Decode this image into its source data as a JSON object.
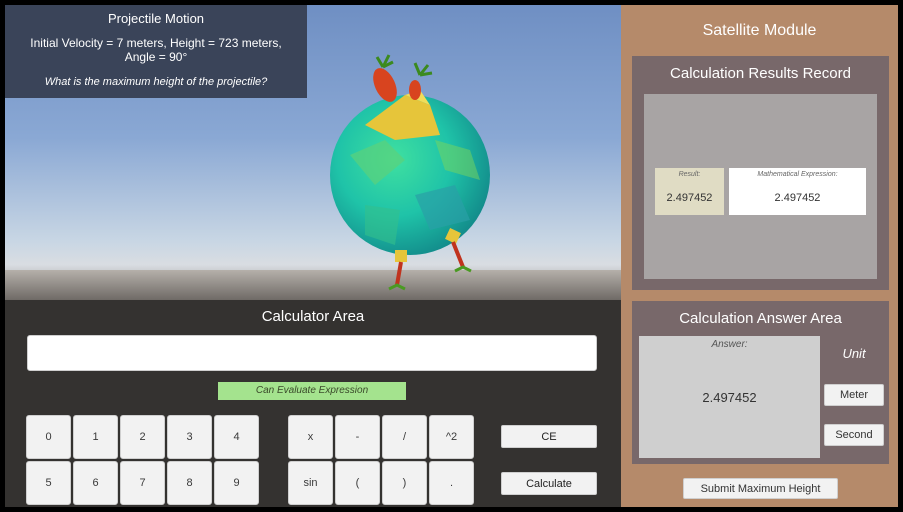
{
  "question": {
    "title": "Projectile Motion",
    "description": "Initial Velocity = 7 meters, Height = 723 meters, Angle = 90°",
    "ask": "What is the maximum height of the projectile?"
  },
  "calculator": {
    "title": "Calculator Area",
    "input_value": "",
    "status": "Can Evaluate Expression",
    "digits": [
      "0",
      "1",
      "2",
      "3",
      "4",
      "5",
      "6",
      "7",
      "8",
      "9"
    ],
    "ops": [
      "x",
      "-",
      "/",
      "^2",
      "sin",
      "(",
      ")",
      "."
    ],
    "ce_label": "CE",
    "calculate_label": "Calculate"
  },
  "side": {
    "title": "Satellite Module",
    "record": {
      "title": "Calculation Results Record",
      "result_label": "Result:",
      "result_value": "2.497452",
      "expr_label": "Mathematical Expression:",
      "expr_value": "2.497452"
    },
    "answer": {
      "title": "Calculation Answer Area",
      "answer_label": "Answer:",
      "answer_value": "2.497452",
      "unit_label": "Unit",
      "meter_label": "Meter",
      "second_label": "Second"
    },
    "submit_label": "Submit Maximum Height"
  },
  "colors": {
    "side_bg": "#b58a6a",
    "panel_bg": "#78686a",
    "calc_bg": "#343230",
    "status_bg": "#a4e38e"
  }
}
